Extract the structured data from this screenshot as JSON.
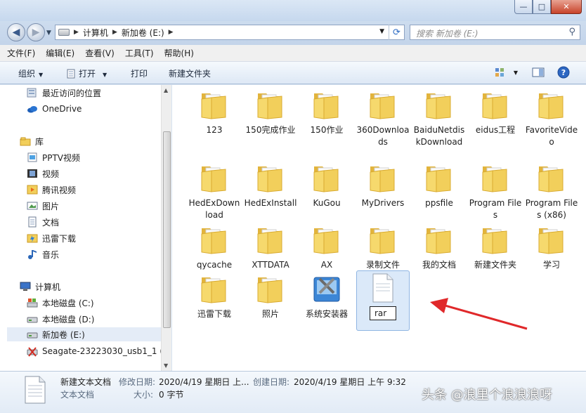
{
  "window": {
    "min_glyph": "—",
    "max_glyph": "□",
    "close_glyph": "✕"
  },
  "address": {
    "crumbs": [
      "计算机",
      "新加卷 (E:)"
    ],
    "search_placeholder": "搜索 新加卷 (E:)"
  },
  "menu": [
    "文件(F)",
    "编辑(E)",
    "查看(V)",
    "工具(T)",
    "帮助(H)"
  ],
  "toolbar": {
    "organize": "组织",
    "open": "打开",
    "print": "打印",
    "new_folder": "新建文件夹"
  },
  "nav": {
    "items": [
      {
        "label": "最近访问的位置",
        "icon": "recent-places-icon"
      },
      {
        "label": "OneDrive",
        "icon": "cloud-icon"
      },
      {
        "label": "库",
        "icon": "library-icon"
      },
      {
        "label": "PPTV视频",
        "icon": "pptv-icon"
      },
      {
        "label": "视频",
        "icon": "video-icon"
      },
      {
        "label": "腾讯视频",
        "icon": "tencent-video-icon"
      },
      {
        "label": "图片",
        "icon": "pictures-icon"
      },
      {
        "label": "文档",
        "icon": "documents-icon"
      },
      {
        "label": "迅雷下载",
        "icon": "thunder-icon"
      },
      {
        "label": "音乐",
        "icon": "music-icon"
      },
      {
        "label": "计算机",
        "icon": "computer-icon"
      },
      {
        "label": "本地磁盘 (C:)",
        "icon": "drive-icon"
      },
      {
        "label": "本地磁盘 (D:)",
        "icon": "drive-icon"
      },
      {
        "label": "新加卷 (E:)",
        "icon": "drive-icon"
      },
      {
        "label": "Seagate-23223030_usb1_1 (\\\\",
        "icon": "network-drive-icon"
      }
    ]
  },
  "files": [
    {
      "name": "123",
      "type": "folder"
    },
    {
      "name": "150完成作业",
      "type": "folder"
    },
    {
      "name": "150作业",
      "type": "folder"
    },
    {
      "name": "360Downloads",
      "type": "folder"
    },
    {
      "name": "BaiduNetdiskDownload",
      "type": "folder"
    },
    {
      "name": "eidus工程",
      "type": "folder"
    },
    {
      "name": "FavoriteVideo",
      "type": "folder"
    },
    {
      "name": "HedExDownload",
      "type": "folder"
    },
    {
      "name": "HedExInstall",
      "type": "folder"
    },
    {
      "name": "KuGou",
      "type": "folder"
    },
    {
      "name": "MyDrivers",
      "type": "folder"
    },
    {
      "name": "ppsfile",
      "type": "folder"
    },
    {
      "name": "Program Files",
      "type": "folder"
    },
    {
      "name": "Program Files (x86)",
      "type": "folder"
    },
    {
      "name": "qycache",
      "type": "folder"
    },
    {
      "name": "XTTDATA",
      "type": "folder"
    },
    {
      "name": "AX",
      "type": "folder"
    },
    {
      "name": "录制文件",
      "type": "folder"
    },
    {
      "name": "我的文档",
      "type": "folder"
    },
    {
      "name": "新建文件夹",
      "type": "folder"
    },
    {
      "name": "学习",
      "type": "folder"
    },
    {
      "name": "迅雷下载",
      "type": "folder"
    },
    {
      "name": "照片",
      "type": "folder"
    },
    {
      "name": "系统安装器",
      "type": "installer"
    },
    {
      "name": "rar",
      "type": "text-file",
      "renaming": true
    }
  ],
  "details": {
    "file_name": "新建文本文档",
    "file_type": "文本文档",
    "modified_label": "修改日期:",
    "modified_value": "2020/4/19 星期日 上...",
    "created_label": "创建日期:",
    "created_value": "2020/4/19 星期日 上午 9:32",
    "size_label": "大小:",
    "size_value": "0 字节"
  },
  "watermark": "头条 @浪里个浪浪浪呀",
  "colors": {
    "arrow": "#e0282a",
    "folder": "#f2cf5b",
    "selection": "#dbe9f9"
  }
}
